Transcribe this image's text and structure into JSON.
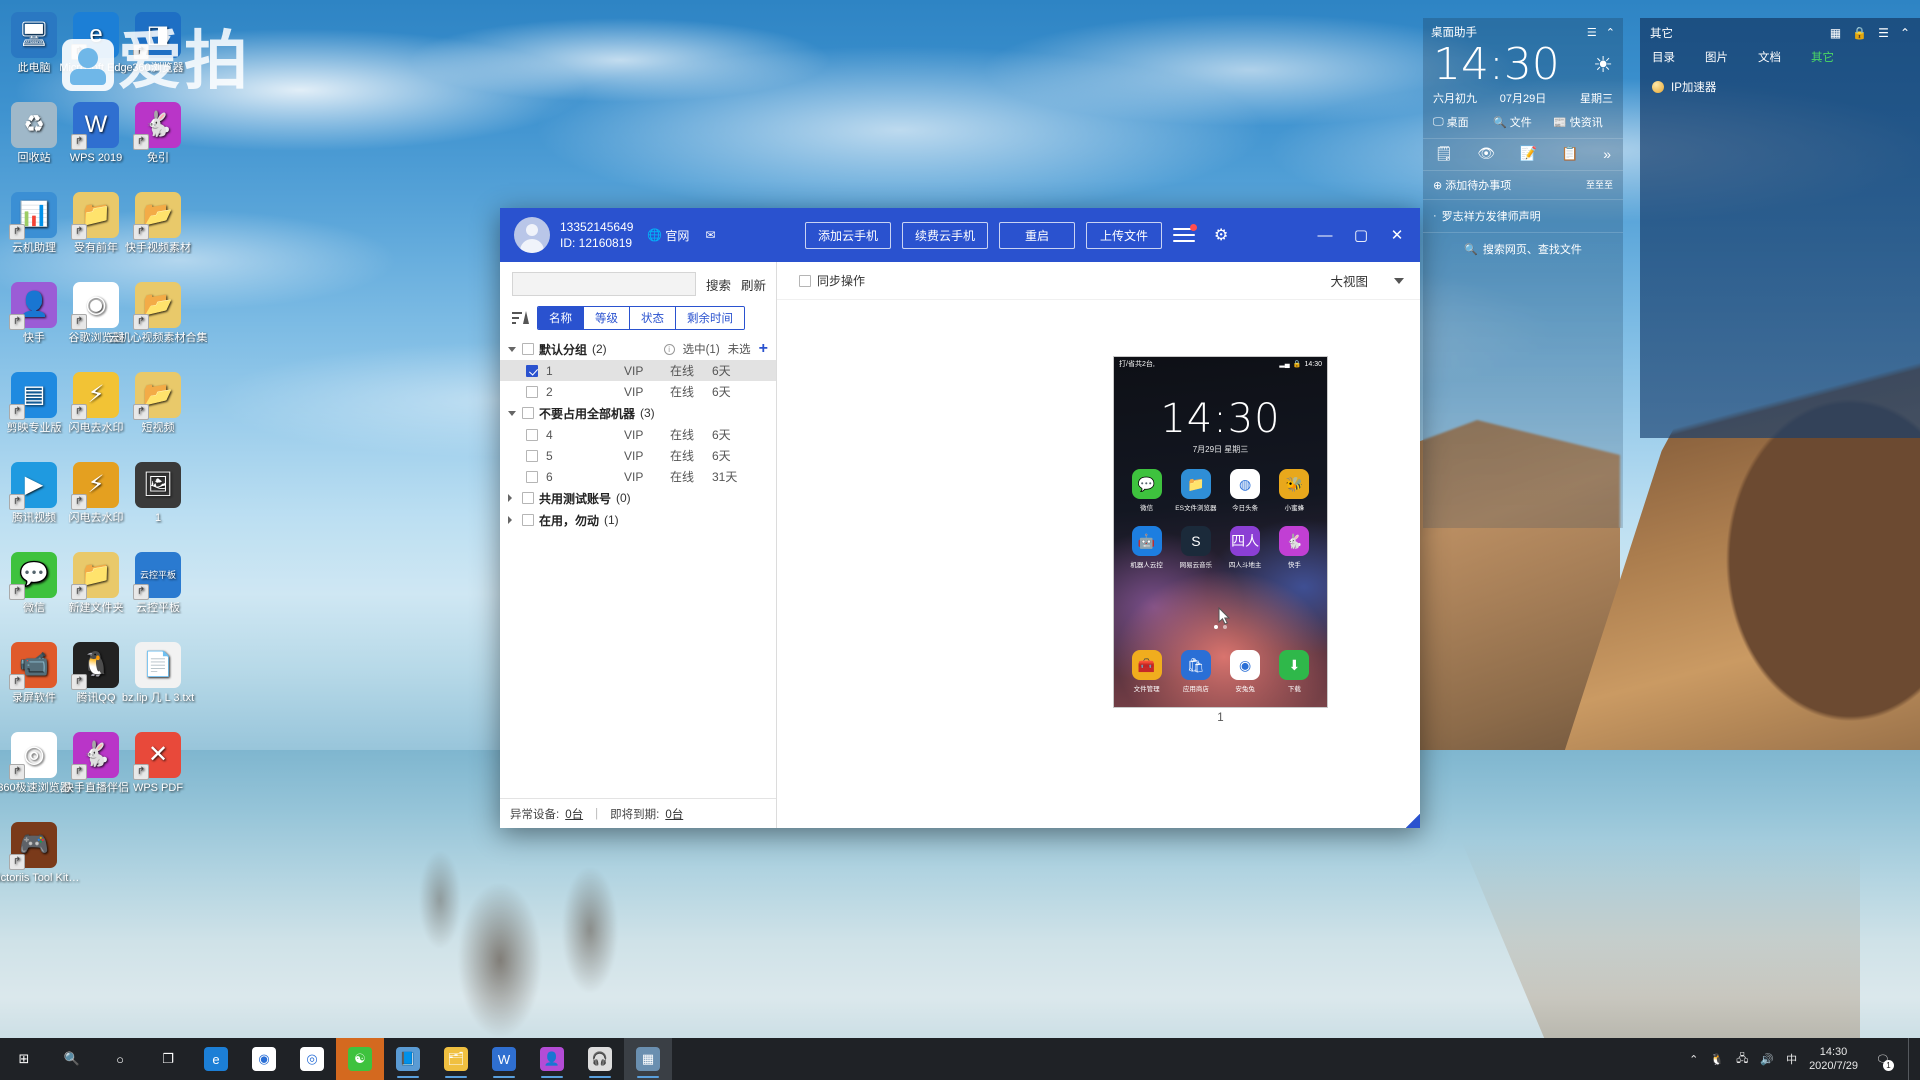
{
  "desktop": {
    "watermark": "爱拍",
    "icons": [
      {
        "label": "此电脑",
        "glyph": "🖥",
        "color": "#2a78c2",
        "shortcut": false
      },
      {
        "label": "Microsoft Edge",
        "glyph": "e",
        "color": "#1c7fd6",
        "shortcut": true
      },
      {
        "label": "360浏览器",
        "glyph": "◨",
        "color": "#1e6fc4",
        "shortcut": true
      },
      {
        "label": "回收站",
        "glyph": "♻",
        "color": "#9fb8c9",
        "shortcut": false
      },
      {
        "label": "WPS 2019",
        "glyph": "W",
        "color": "#2f6fd0",
        "shortcut": true
      },
      {
        "label": "免引",
        "glyph": "🐇",
        "color": "#b935c8",
        "shortcut": true
      },
      {
        "label": "云机助理",
        "glyph": "📊",
        "color": "#3b8fd4",
        "shortcut": true
      },
      {
        "label": "受有前年",
        "glyph": "📁",
        "color": "#e9c96a",
        "shortcut": true
      },
      {
        "label": "快手视频素材",
        "glyph": "📂",
        "color": "#e9c96a",
        "shortcut": true
      },
      {
        "label": "快手",
        "glyph": "👤",
        "color": "#9b5cd6",
        "shortcut": true
      },
      {
        "label": "谷歌浏览器",
        "glyph": "◉",
        "color": "#ffffff",
        "shortcut": true
      },
      {
        "label": "云机心视频素材合集",
        "glyph": "📂",
        "color": "#e9c96a",
        "shortcut": true
      },
      {
        "label": "剪映专业版",
        "glyph": "▤",
        "color": "#1f8ae0",
        "shortcut": true
      },
      {
        "label": "闪电去水印",
        "glyph": "⚡",
        "color": "#f2c335",
        "shortcut": true
      },
      {
        "label": "短视频",
        "glyph": "📂",
        "color": "#e9c96a",
        "shortcut": true
      },
      {
        "label": "腾讯视频",
        "glyph": "▶",
        "color": "#1f9ae0",
        "shortcut": true
      },
      {
        "label": "闪电去水印",
        "glyph": "⚡",
        "color": "#e4a020",
        "shortcut": true
      },
      {
        "label": "1",
        "glyph": "🖼",
        "color": "#3a3a3a",
        "shortcut": false
      },
      {
        "label": "微信",
        "glyph": "💬",
        "color": "#3ec23e",
        "shortcut": true
      },
      {
        "label": "新建文件夹",
        "glyph": "📁",
        "color": "#e9c96a",
        "shortcut": true
      },
      {
        "label": "云控平板",
        "glyph": "云控平板",
        "color": "#2a7ad0",
        "shortcut": true
      },
      {
        "label": "录屏软件",
        "glyph": "📹",
        "color": "#e05a2b",
        "shortcut": true
      },
      {
        "label": "腾讯QQ",
        "glyph": "🐧",
        "color": "#222222",
        "shortcut": true
      },
      {
        "label": "bz.lip 几 L 3.txt",
        "glyph": "📄",
        "color": "#f2f2f2",
        "shortcut": false
      },
      {
        "label": "360极速浏览器",
        "glyph": "◎",
        "color": "#ffffff",
        "shortcut": true
      },
      {
        "label": "快手直播伴侣",
        "glyph": "🐇",
        "color": "#b935c8",
        "shortcut": true
      },
      {
        "label": "WPS PDF",
        "glyph": "✕",
        "color": "#e8493a",
        "shortcut": true
      },
      {
        "label": "Viictoriis Tool Kit…",
        "glyph": "🎮",
        "color": "#7a3a1a",
        "shortcut": true
      }
    ]
  },
  "app": {
    "account": {
      "phone": "13352145649",
      "id_label": "ID: 12160819"
    },
    "header_links": [
      {
        "name": "official-site",
        "label": "官网",
        "icon": "globe-icon"
      },
      {
        "name": "mail",
        "label": "",
        "icon": "mail-icon"
      }
    ],
    "toolbar_buttons": [
      {
        "name": "add-cloud-phone",
        "label": "添加云手机"
      },
      {
        "name": "renew-cloud-phone",
        "label": "续费云手机"
      },
      {
        "name": "restart",
        "label": "重启"
      },
      {
        "name": "upload-file",
        "label": "上传文件"
      }
    ],
    "window_controls": {
      "minimize": "—",
      "maximize": "▢",
      "close": "✕"
    },
    "search": {
      "value": "",
      "placeholder": "",
      "search_label": "搜索",
      "refresh_label": "刷新"
    },
    "columns": [
      {
        "name": "name",
        "label": "名称",
        "active": true
      },
      {
        "name": "level",
        "label": "等级",
        "active": false
      },
      {
        "name": "status",
        "label": "状态",
        "active": false
      },
      {
        "name": "remaining",
        "label": "剩余时间",
        "active": false
      }
    ],
    "tree": [
      {
        "name": "默认分组",
        "count": "(2)",
        "expanded": true,
        "checked": false,
        "selected_label": "选中(1)",
        "unselected_label": "未选",
        "add_label": "+",
        "rows": [
          {
            "name": "1",
            "level": "VIP",
            "status": "在线",
            "remaining": "6天",
            "checked": true,
            "selected": true
          },
          {
            "name": "2",
            "level": "VIP",
            "status": "在线",
            "remaining": "6天",
            "checked": false,
            "selected": false
          }
        ]
      },
      {
        "name": "不要占用全部机器",
        "count": "(3)",
        "expanded": true,
        "checked": false,
        "selected_label": "",
        "unselected_label": "",
        "add_label": "",
        "rows": [
          {
            "name": "4",
            "level": "VIP",
            "status": "在线",
            "remaining": "6天",
            "checked": false,
            "selected": false
          },
          {
            "name": "5",
            "level": "VIP",
            "status": "在线",
            "remaining": "6天",
            "checked": false,
            "selected": false
          },
          {
            "name": "6",
            "level": "VIP",
            "status": "在线",
            "remaining": "31天",
            "checked": false,
            "selected": false
          }
        ]
      },
      {
        "name": "共用测试账号",
        "count": "(0)",
        "expanded": false,
        "checked": false,
        "selected_label": "",
        "unselected_label": "",
        "add_label": "",
        "rows": []
      },
      {
        "name": "在用，勿动",
        "count": "(1)",
        "expanded": false,
        "checked": false,
        "selected_label": "",
        "unselected_label": "",
        "add_label": "",
        "rows": []
      }
    ],
    "status_bar": {
      "abnormal_label": "异常设备:",
      "abnormal_value": "0台",
      "expiring_label": "即将到期:",
      "expiring_value": "0台"
    },
    "main": {
      "sync_label": "同步操作",
      "sync_checked": false,
      "view_mode": "大视图"
    },
    "phone_preview": {
      "label": "1",
      "status_left": "打/省共2台,",
      "status_time": "14:30",
      "clock": "14:30",
      "date": "7月29日  星期三",
      "apps": [
        {
          "label": "微信",
          "glyph": "💬",
          "color": "#3ec23e"
        },
        {
          "label": "ES文件浏览器",
          "glyph": "📁",
          "color": "#2f8ed6"
        },
        {
          "label": "今日头条",
          "glyph": "◍",
          "color": "#ffffff"
        },
        {
          "label": "小蜜蜂",
          "glyph": "🐝",
          "color": "#e8a81c"
        },
        {
          "label": "机器人云控",
          "glyph": "🤖",
          "color": "#1d7ee0"
        },
        {
          "label": "网易云音乐",
          "glyph": "S",
          "color": "#1b2a3a"
        },
        {
          "label": "四人斗地主",
          "glyph": "四人",
          "color": "#8b3fd4"
        },
        {
          "label": "快手",
          "glyph": "🐇",
          "color": "#c13fd4"
        }
      ],
      "dock": [
        {
          "label": "文件管理",
          "glyph": "🧰",
          "color": "#f0ad1e"
        },
        {
          "label": "应用商店",
          "glyph": "🛍",
          "color": "#2a6fd6"
        },
        {
          "label": "安兔兔",
          "glyph": "◉",
          "color": "#ffffff"
        },
        {
          "label": "下载",
          "glyph": "⬇",
          "color": "#2fb84a"
        }
      ],
      "page_dots": 2,
      "active_dot": 0
    }
  },
  "assistant": {
    "title": "桌面助手",
    "clock": "14:30",
    "weather_icon": "sun-icon",
    "lunar_date": "六月初九",
    "date": "07月29日",
    "weekday": "星期三",
    "quick_links": [
      {
        "name": "desktop",
        "label": "桌面",
        "icon": "desktop-icon"
      },
      {
        "name": "files",
        "label": "文件",
        "icon": "search-icon"
      },
      {
        "name": "news",
        "label": "快资讯",
        "icon": "news-icon"
      }
    ],
    "tools": [
      "note-icon",
      "eye-icon",
      "edit-icon",
      "calendar-icon",
      "more-icon"
    ],
    "todo_label": "添加待办事项",
    "todo_right": "至至至",
    "news_item": "罗志祥方发律师声明",
    "search_placeholder": "搜索网页、查找文件"
  },
  "other_panel": {
    "title": "其它",
    "header_icons": [
      "grid-icon",
      "lock-icon",
      "menu-icon",
      "collapse-icon"
    ],
    "tabs": [
      {
        "name": "directory",
        "label": "目录",
        "active": false
      },
      {
        "name": "images",
        "label": "图片",
        "active": false
      },
      {
        "name": "documents",
        "label": "文档",
        "active": false
      },
      {
        "name": "other",
        "label": "其它",
        "active": true
      }
    ],
    "items": [
      {
        "label": "IP加速器",
        "icon": "app-icon"
      }
    ],
    "accent_color": "#4cd964"
  },
  "taskbar": {
    "start": "windows-icon",
    "items": [
      {
        "name": "start",
        "glyph": "⊞",
        "color": "transparent",
        "state": ""
      },
      {
        "name": "search",
        "glyph": "🔍",
        "color": "transparent",
        "state": ""
      },
      {
        "name": "cortana",
        "glyph": "○",
        "color": "transparent",
        "state": ""
      },
      {
        "name": "task-view",
        "glyph": "❐",
        "color": "transparent",
        "state": ""
      },
      {
        "name": "edge",
        "glyph": "e",
        "color": "#1c7fd6",
        "state": ""
      },
      {
        "name": "chrome",
        "glyph": "◉",
        "color": "#ffffff",
        "state": ""
      },
      {
        "name": "360-browser",
        "glyph": "◎",
        "color": "#ffffff",
        "state": ""
      },
      {
        "name": "cloud-phone-app",
        "glyph": "☯",
        "color": "#3ec23e",
        "state": "active"
      },
      {
        "name": "book-app",
        "glyph": "📘",
        "color": "#5a9bd4",
        "state": "running"
      },
      {
        "name": "file-explorer",
        "glyph": "🗂",
        "color": "#f0c040",
        "state": "running"
      },
      {
        "name": "wps",
        "glyph": "W",
        "color": "#2f6fd0",
        "state": "running"
      },
      {
        "name": "kuaishou",
        "glyph": "👤",
        "color": "#b44cd6",
        "state": "running"
      },
      {
        "name": "headphone-app",
        "glyph": "🎧",
        "color": "#dddddd",
        "state": "running"
      },
      {
        "name": "cloud-control-panel",
        "glyph": "▦",
        "color": "#6a8fb0",
        "state": "active2"
      }
    ],
    "tray": {
      "chevron": "⌃",
      "icons": [
        {
          "name": "qq-tray-icon",
          "glyph": "🐧"
        },
        {
          "name": "network-tray-icon",
          "glyph": "🖧"
        },
        {
          "name": "volume-tray-icon",
          "glyph": "🔊"
        },
        {
          "name": "ime-tray-icon",
          "glyph": "中"
        }
      ],
      "time": "14:30",
      "date": "2020/7/29",
      "notification_count": "1"
    }
  }
}
